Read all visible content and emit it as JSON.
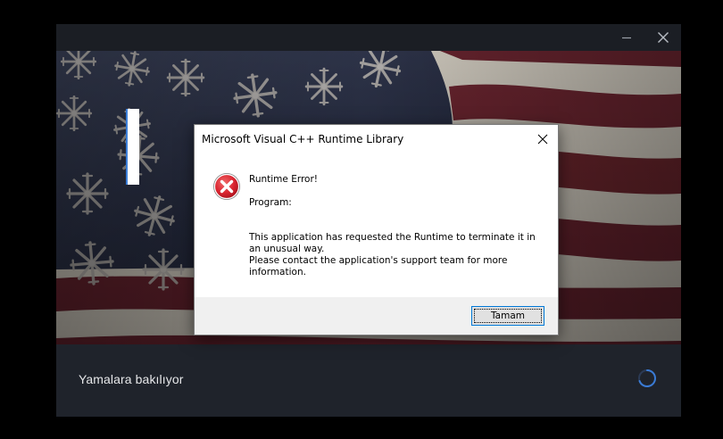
{
  "launcher": {
    "status_text": "Yamalara bakılıyor",
    "icons": {
      "minimize": "minimize-icon",
      "close": "close-icon",
      "spinner": "loading-spinner-icon"
    },
    "colors": {
      "background": "#1b1f26",
      "footer": "#1f232b",
      "status_text": "#e6e7e9",
      "spinner": "#3a7bd5"
    }
  },
  "dialog": {
    "title": "Microsoft Visual C++ Runtime Library",
    "heading": "Runtime Error!",
    "program_label": "Program:",
    "body_lines": [
      "This application has requested the Runtime to terminate it in",
      "an unusual way.",
      "Please contact the application's support team for more",
      "information."
    ],
    "ok_label": "Tamam",
    "icons": {
      "error": "error-icon",
      "close": "close-icon"
    },
    "colors": {
      "error_red": "#d9232e",
      "button_border": "#0078d7"
    }
  }
}
